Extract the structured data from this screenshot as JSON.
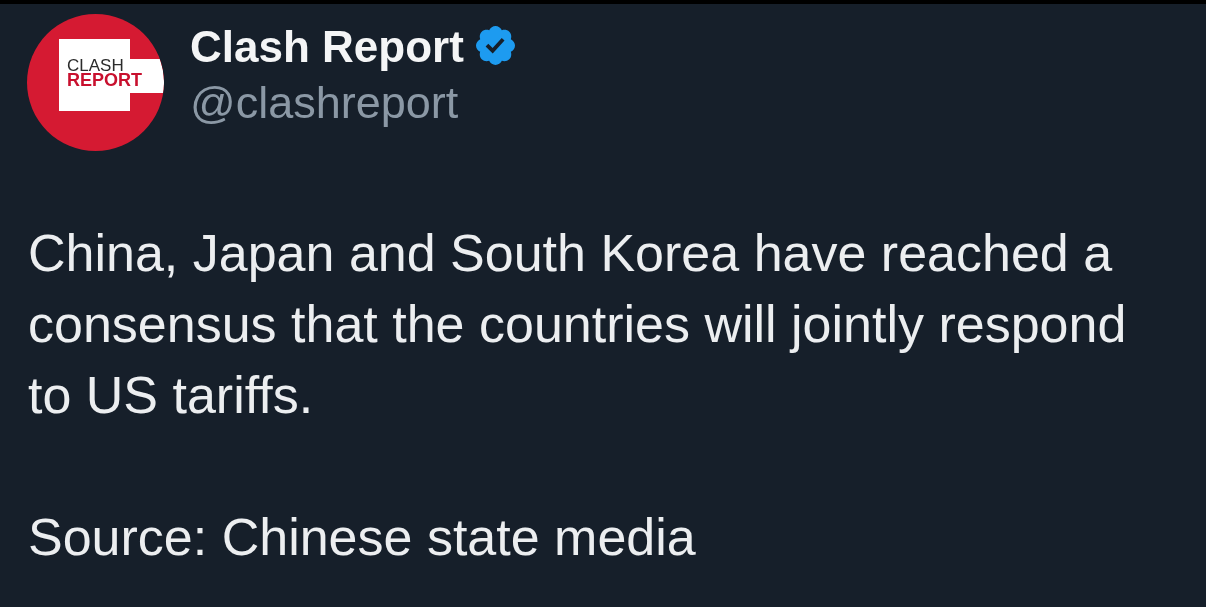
{
  "post": {
    "avatar": {
      "logo_lines": [
        {
          "text": "CLASH",
          "kind": "light"
        },
        {
          "text": "REPORT",
          "kind": "bold"
        }
      ]
    },
    "author": {
      "name": "Clash Report",
      "verified": true,
      "handle": "@clashreport"
    },
    "paragraphs": [
      "China, Japan and South Korea have reached a consensus that the countries will jointly respond to US tariffs.",
      "Source: Chinese state media"
    ]
  }
}
